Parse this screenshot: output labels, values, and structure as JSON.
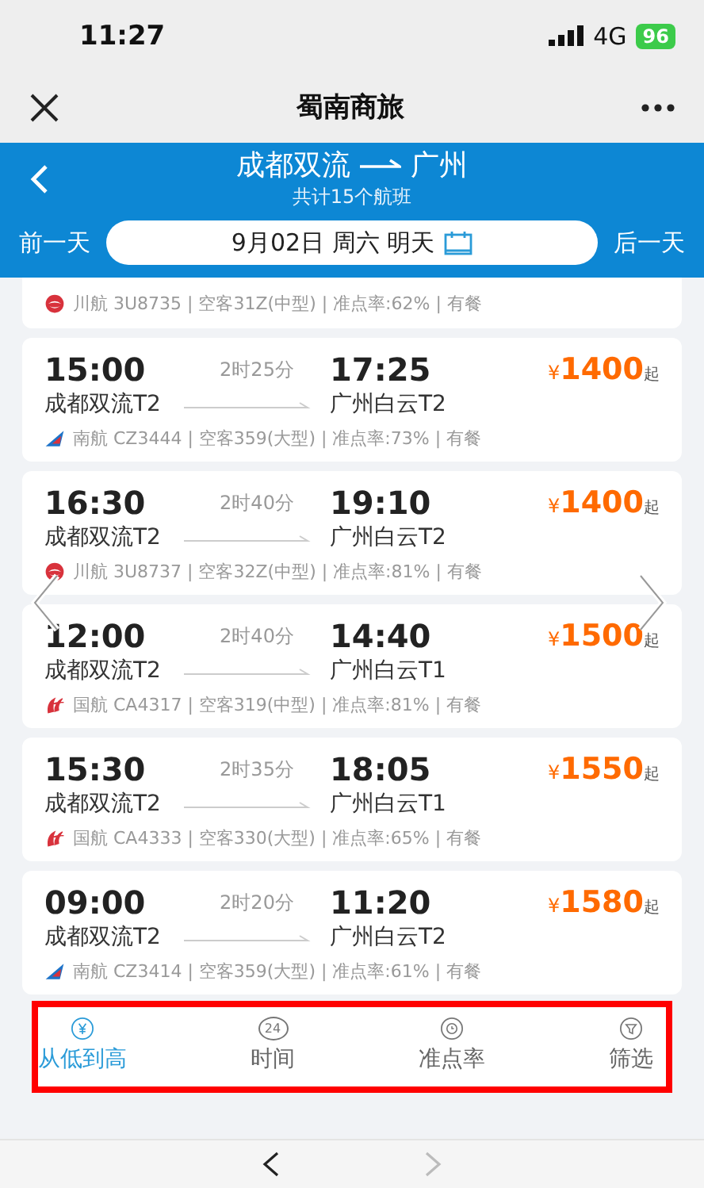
{
  "status_bar": {
    "time": "11:27",
    "network": "4G",
    "battery": "96"
  },
  "nav": {
    "title": "蜀南商旅"
  },
  "header": {
    "route_from": "成都双流",
    "route_to": "广州",
    "subtitle": "共计15个航班",
    "prev_day": "前一天",
    "date": "9月02日 周六 明天",
    "next_day": "后一天"
  },
  "top_info": {
    "kind": "sichuan",
    "info": "川航 3U8735 | 空客31Z(中型) | 准点率:62% | 有餐"
  },
  "flights": [
    {
      "dep_time": "15:00",
      "duration": "2时25分",
      "arr_time": "17:25",
      "dep_airport": "成都双流T2",
      "arr_airport": "广州白云T2",
      "currency": "¥",
      "price": "1400",
      "price_suffix": "起",
      "kind": "southern",
      "info": "南航 CZ3444 | 空客359(大型) | 准点率:73% | 有餐"
    },
    {
      "dep_time": "16:30",
      "duration": "2时40分",
      "arr_time": "19:10",
      "dep_airport": "成都双流T2",
      "arr_airport": "广州白云T2",
      "currency": "¥",
      "price": "1400",
      "price_suffix": "起",
      "kind": "sichuan",
      "info": "川航 3U8737 | 空客32Z(中型) | 准点率:81% | 有餐"
    },
    {
      "dep_time": "12:00",
      "duration": "2时40分",
      "arr_time": "14:40",
      "dep_airport": "成都双流T2",
      "arr_airport": "广州白云T1",
      "currency": "¥",
      "price": "1500",
      "price_suffix": "起",
      "kind": "airchina",
      "info": "国航 CA4317 | 空客319(中型) | 准点率:81% | 有餐"
    },
    {
      "dep_time": "15:30",
      "duration": "2时35分",
      "arr_time": "18:05",
      "dep_airport": "成都双流T2",
      "arr_airport": "广州白云T1",
      "currency": "¥",
      "price": "1550",
      "price_suffix": "起",
      "kind": "airchina",
      "info": "国航 CA4333 | 空客330(大型) | 准点率:65% | 有餐"
    },
    {
      "dep_time": "09:00",
      "duration": "2时20分",
      "arr_time": "11:20",
      "dep_airport": "成都双流T2",
      "arr_airport": "广州白云T2",
      "currency": "¥",
      "price": "1580",
      "price_suffix": "起",
      "kind": "southern",
      "info": "南航 CZ3414 | 空客359(大型) | 准点率:61% | 有餐"
    }
  ],
  "sort_tabs": [
    {
      "label": "从低到高",
      "selected": true
    },
    {
      "label": "时间",
      "icon_text": "24",
      "selected": false
    },
    {
      "label": "准点率",
      "selected": false
    },
    {
      "label": "筛选",
      "selected": false
    }
  ],
  "browser_bar": {
    "back_disabled": false,
    "forward_disabled": true
  }
}
